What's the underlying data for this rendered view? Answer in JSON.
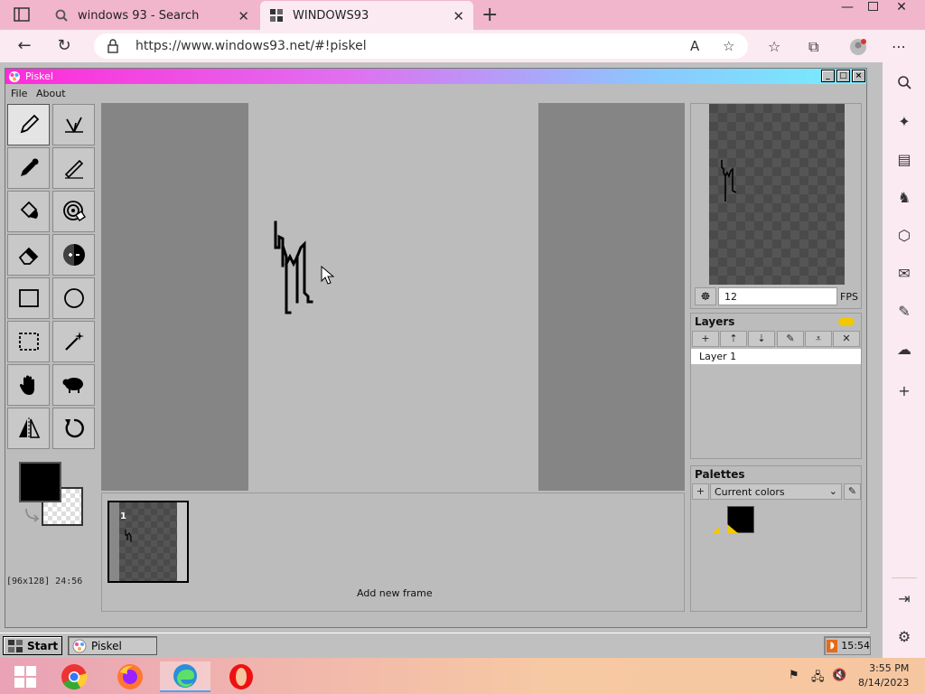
{
  "browser": {
    "tabs": [
      {
        "title": "windows 93 - Search",
        "icon": "search-icon"
      },
      {
        "title": "WINDOWS93",
        "icon": "windows93-icon"
      }
    ],
    "url": "https://www.windows93.net/#!piskel"
  },
  "window": {
    "title": "Piskel",
    "menu": [
      "File",
      "About"
    ]
  },
  "tools": [
    "pen-icon",
    "vertical-mirror-pen-icon",
    "eyedropper-icon",
    "stroke-icon",
    "paint-bucket-icon",
    "paint-same-color-icon",
    "eraser-icon",
    "lighten-icon",
    "rectangle-icon",
    "circle-icon",
    "rectangle-select-icon",
    "magic-wand-icon",
    "hand-icon",
    "dithering-icon",
    "flip-icon",
    "rotate-icon"
  ],
  "colors": {
    "primary": "#000000",
    "accent_title": "#ff2bd9"
  },
  "status": "[96x128] 24:56",
  "frames": {
    "thumb_label": "1",
    "add_frame": "Add new frame"
  },
  "preview": {
    "fps": "12",
    "fps_label": "FPS"
  },
  "layers": {
    "title": "Layers",
    "items": [
      "Layer 1"
    ]
  },
  "palettes": {
    "title": "Palettes",
    "selected": "Current colors"
  },
  "w93_taskbar": {
    "start": "Start",
    "task": "Piskel",
    "clock": "15:54"
  },
  "os_taskbar": {
    "time": "3:55 PM",
    "date": "8/14/2023"
  }
}
